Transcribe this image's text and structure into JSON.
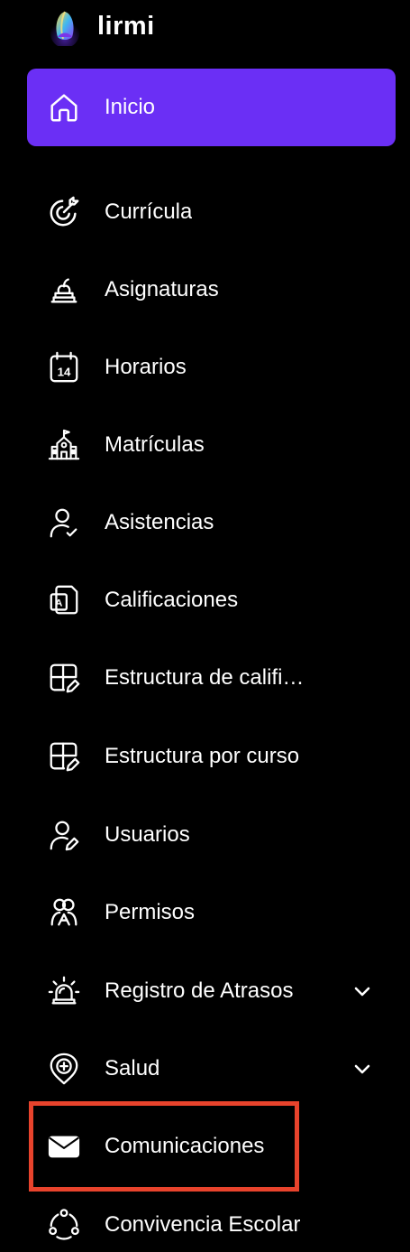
{
  "brand": {
    "name": "lirmi"
  },
  "colors": {
    "background": "#000000",
    "active": "#6b2ff5",
    "text": "#ffffff",
    "highlight": "#e8432c"
  },
  "nav": [
    {
      "label": "Inicio",
      "icon": "home-icon",
      "active": true
    },
    {
      "label": "Currícula",
      "icon": "target-icon"
    },
    {
      "label": "Asignaturas",
      "icon": "books-apple-icon"
    },
    {
      "label": "Horarios",
      "icon": "calendar-14-icon"
    },
    {
      "label": "Matrículas",
      "icon": "school-building-icon"
    },
    {
      "label": "Asistencias",
      "icon": "user-check-icon"
    },
    {
      "label": "Calificaciones",
      "icon": "grade-document-icon"
    },
    {
      "label": "Estructura de califi…",
      "icon": "grid-edit-icon"
    },
    {
      "label": "Estructura por curso",
      "icon": "grid-edit-icon"
    },
    {
      "label": "Usuarios",
      "icon": "user-edit-icon"
    },
    {
      "label": "Permisos",
      "icon": "users-permissions-icon"
    },
    {
      "label": "Registro de Atrasos",
      "icon": "alarm-light-icon",
      "expandable": true
    },
    {
      "label": "Salud",
      "icon": "health-pin-icon",
      "expandable": true
    },
    {
      "label": "Comunicaciones",
      "icon": "envelope-icon",
      "highlighted": true
    },
    {
      "label": "Convivencia Escolar",
      "icon": "people-circle-icon"
    }
  ]
}
